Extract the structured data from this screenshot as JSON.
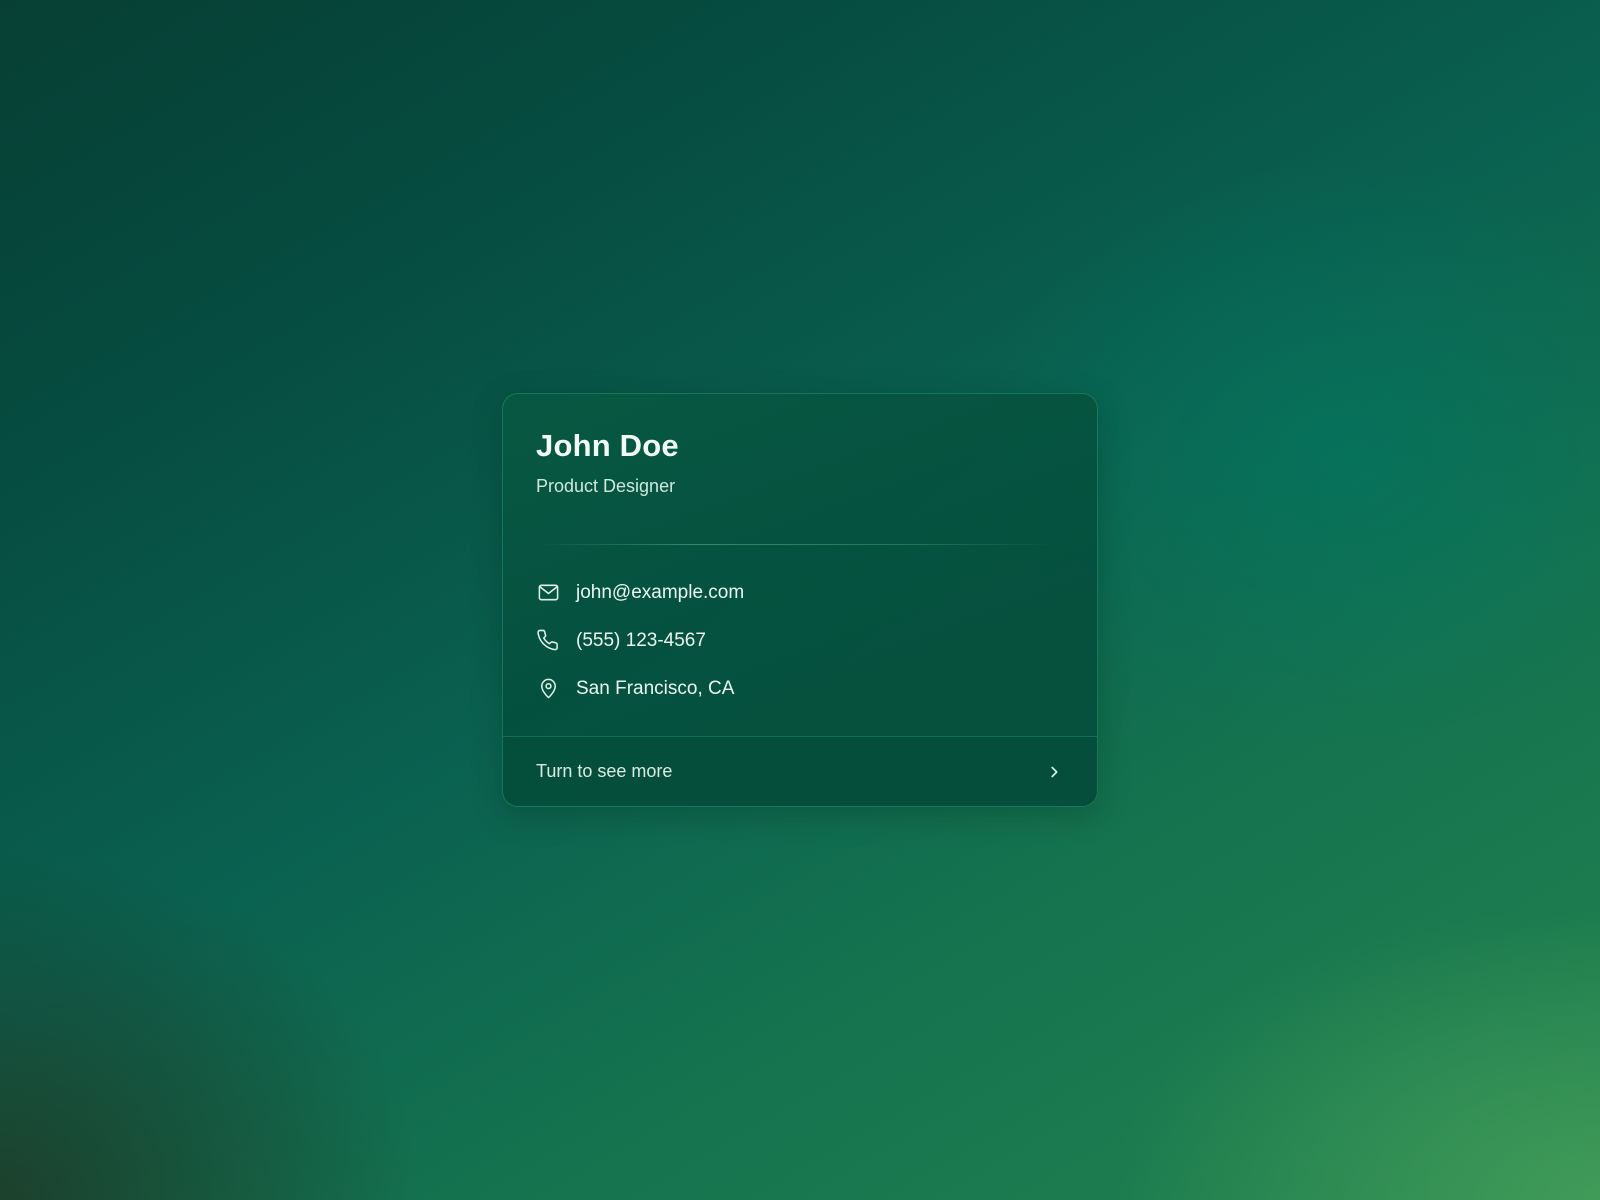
{
  "card": {
    "name": "John Doe",
    "title": "Product Designer",
    "contacts": [
      {
        "icon": "mail-icon",
        "text": "john@example.com"
      },
      {
        "icon": "phone-icon",
        "text": "(555) 123-4567"
      },
      {
        "icon": "map-pin-icon",
        "text": "San Francisco, CA"
      }
    ],
    "footer_label": "Turn to see more",
    "footer_icon": "chevron-right-icon"
  },
  "colors": {
    "card_background": "#05503e",
    "card_border": "#28aa78",
    "text_primary": "#f3fbf7",
    "text_secondary": "#cfe8dc",
    "icon_stroke": "#dff2e8"
  }
}
